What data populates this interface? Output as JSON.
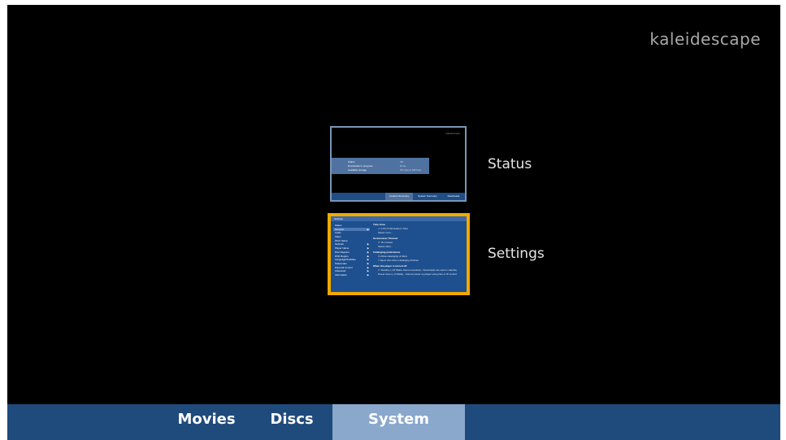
{
  "brand": "kaleidescape",
  "menu": {
    "items": [
      {
        "label": "Status"
      },
      {
        "label": "Settings"
      }
    ],
    "selected_index": 1
  },
  "status_preview": {
    "brand": "kaleidescape",
    "rows": [
      {
        "label": "Status",
        "value": "OK"
      },
      {
        "label": "Downloads in progress",
        "value": "None"
      },
      {
        "label": "Available storage",
        "value": "3% (lots of GB free)"
      }
    ],
    "tabs": [
      "Content Summary",
      "System Summary",
      "Downloads"
    ]
  },
  "settings_preview": {
    "title": "Settings",
    "categories": [
      "Status",
      "General",
      "Audio",
      "Video",
      "Wi-Fi Setup",
      "Network",
      "Player Name",
      "Disc Regions",
      "DVD Region",
      "Language/Subtitles",
      "Passcodes",
      "Parental Control",
      "Advanced",
      "Information"
    ],
    "sections": [
      {
        "heading": "Time Zone",
        "options": [
          "(UTC-5:00) Eastern Time",
          "Select zone..."
        ]
      },
      {
        "heading": "Screensaver Timeout",
        "options": [
          "15 minutes",
          "Select other..."
        ]
      },
      {
        "heading": "Cataloging preferences",
        "options": [
          "Allow cataloging of discs",
          "Eject disc when cataloging finishes"
        ]
      },
      {
        "heading": "When the player is turned off",
        "options": [
          "Standby (~15 Watts, Recommended) - Downloads can start in standby",
          "Power down (~3 Watts) - Cannot power up player using Pan or IP control"
        ]
      }
    ]
  },
  "tabs": {
    "movies": "Movies",
    "discs": "Discs",
    "system": "System",
    "active": "System"
  },
  "colors": {
    "background": "#000000",
    "tabbar": "#1f4a7c",
    "tab_active": "#8aa7cc",
    "selection": "#f2a900",
    "brand_text": "#a8a8a8"
  }
}
